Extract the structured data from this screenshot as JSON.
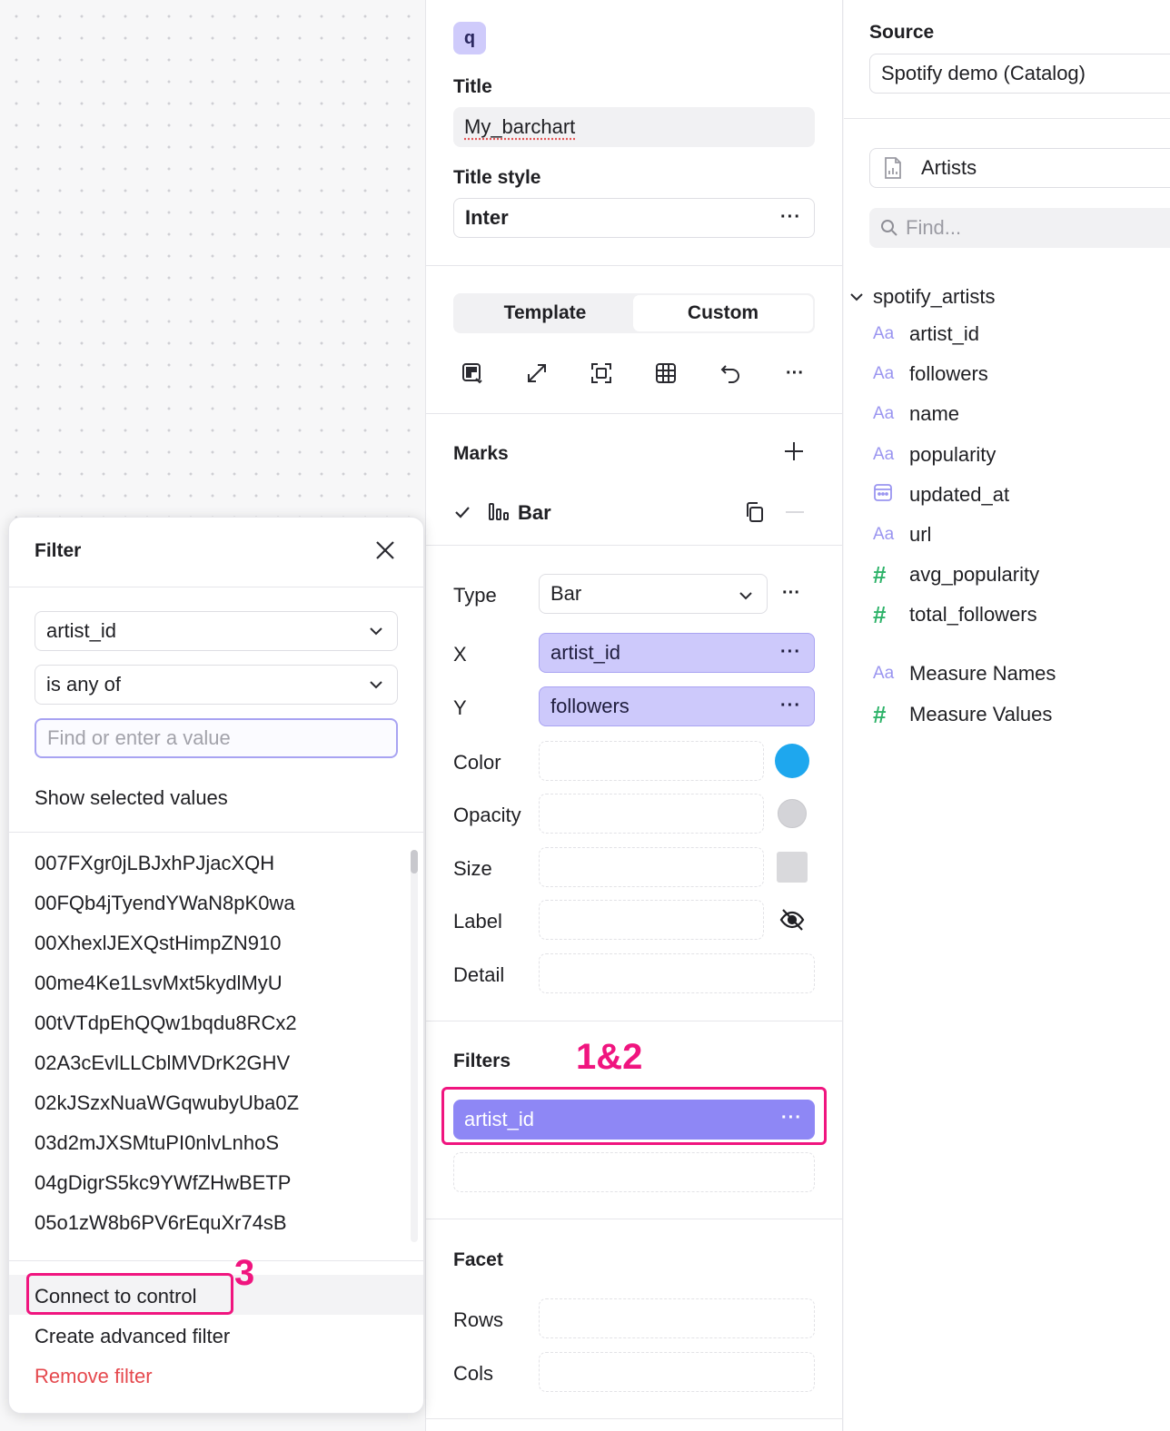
{
  "canvas": {},
  "mid": {
    "query_badge": "q",
    "title_label": "Title",
    "title_value": "My_barchart",
    "title_style_label": "Title style",
    "title_style_value": "Inter",
    "more": "···",
    "tabs": {
      "template": "Template",
      "custom": "Custom",
      "active": "Custom"
    },
    "marks_label": "Marks",
    "mark_name": "Bar",
    "encodings": {
      "type_label": "Type",
      "type_value": "Bar",
      "x_label": "X",
      "x_value": "artist_id",
      "y_label": "Y",
      "y_value": "followers",
      "color_label": "Color",
      "color_swatch": "#1ea7ee",
      "opacity_label": "Opacity",
      "opacity_swatch": "#d4d4d8",
      "size_label": "Size",
      "size_swatch": "#d9d9dc",
      "label_label": "Label",
      "detail_label": "Detail"
    },
    "filters_label": "Filters",
    "filter_chip": "artist_id",
    "facet_label": "Facet",
    "rows_label": "Rows",
    "cols_label": "Cols"
  },
  "annotations": {
    "a12": "1&2",
    "a3": "3",
    "color": "#f0157f"
  },
  "right": {
    "source_label": "Source",
    "source_value": "Spotify demo (Catalog)",
    "dataset": "Artists",
    "search_placeholder": "Find...",
    "table_name": "spotify_artists",
    "fields": [
      {
        "type": "Aa",
        "name": "artist_id"
      },
      {
        "type": "Aa",
        "name": "followers"
      },
      {
        "type": "Aa",
        "name": "name"
      },
      {
        "type": "Aa",
        "name": "popularity"
      },
      {
        "type": "date",
        "name": "updated_at"
      },
      {
        "type": "Aa",
        "name": "url"
      },
      {
        "type": "#",
        "name": "avg_popularity"
      },
      {
        "type": "#",
        "name": "total_followers"
      }
    ],
    "measures": [
      {
        "type": "Aa",
        "name": "Measure Names"
      },
      {
        "type": "#",
        "name": "Measure Values"
      }
    ]
  },
  "filter_popup": {
    "title": "Filter",
    "field": "artist_id",
    "operator": "is any of",
    "value_placeholder": "Find or enter a value",
    "show_selected": "Show selected values",
    "values": [
      "007FXgr0jLBJxhPJjacXQH",
      "00FQb4jTyendYWaN8pK0wa",
      "00XhexlJEXQstHimpZN910",
      "00me4Ke1LsvMxt5kydlMyU",
      "00tVTdpEhQQw1bqdu8RCx2",
      "02A3cEvlLLCblMVDrK2GHV",
      "02kJSzxNuaWGqwubyUba0Z",
      "03d2mJXSMtuPI0nlvLnhoS",
      "04gDigrS5kc9YWfZHwBETP",
      "05o1zW8b6PV6rEquXr74sB"
    ],
    "connect": "Connect to control",
    "advanced": "Create advanced filter",
    "remove": "Remove filter",
    "remove_color": "#e5484d"
  }
}
